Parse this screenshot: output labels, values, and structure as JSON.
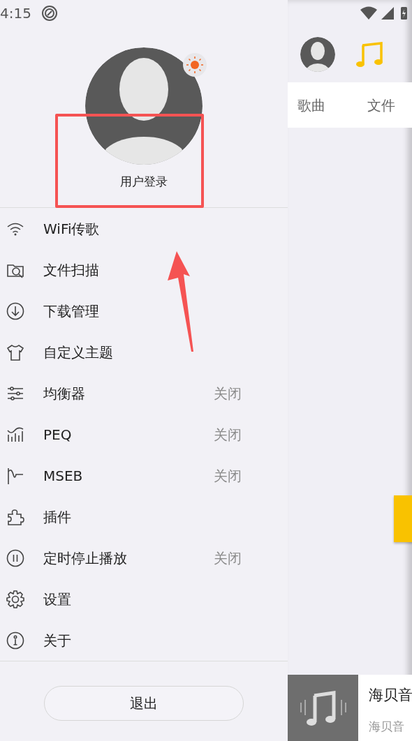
{
  "status_bar": {
    "time": "4:15"
  },
  "profile": {
    "login_label": "用户登录"
  },
  "menu": [
    {
      "label": "WiFi传歌"
    },
    {
      "label": "文件扫描"
    },
    {
      "label": "下载管理"
    },
    {
      "label": "自定义主题"
    },
    {
      "label": "均衡器",
      "status": "关闭"
    },
    {
      "label": "PEQ",
      "status": "关闭"
    },
    {
      "label": "MSEB",
      "status": "关闭"
    },
    {
      "label": "插件"
    },
    {
      "label": "定时停止播放",
      "status": "关闭"
    },
    {
      "label": "设置"
    },
    {
      "label": "关于"
    }
  ],
  "exit_button": "退出",
  "main_panel": {
    "tabs": [
      {
        "label": "歌曲"
      },
      {
        "label": "文件"
      }
    ],
    "player": {
      "title": "海贝音",
      "subtitle": "海贝音"
    }
  }
}
